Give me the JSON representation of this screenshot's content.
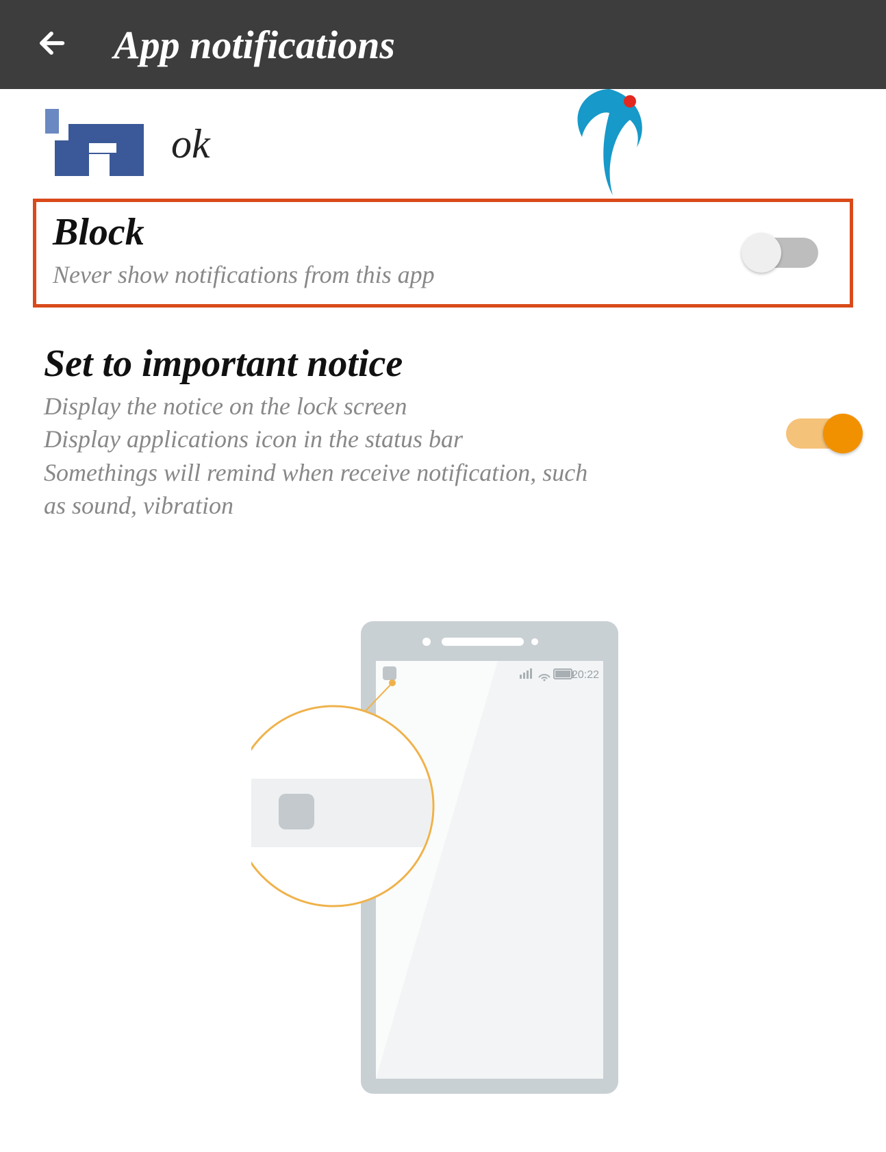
{
  "header": {
    "title": "App notifications"
  },
  "app": {
    "name_partial": "ok"
  },
  "settings": {
    "block": {
      "title": "Block",
      "description": "Never show notifications from this app",
      "enabled": false,
      "highlighted": true
    },
    "important": {
      "title": "Set to important notice",
      "description": "Display the notice on the lock screen\nDisplay applications icon in the status bar\nSomethings will remind when receive notification, such as sound, vibration",
      "enabled": true,
      "highlighted": false
    }
  },
  "illustration": {
    "clock": "20:22"
  },
  "colors": {
    "highlight_border": "#d94a1a",
    "toggle_on": "#f29100",
    "toggle_on_track": "#f5c27a",
    "toggle_off_track": "#bdbdbd",
    "header_bg": "#3d3d3d"
  }
}
